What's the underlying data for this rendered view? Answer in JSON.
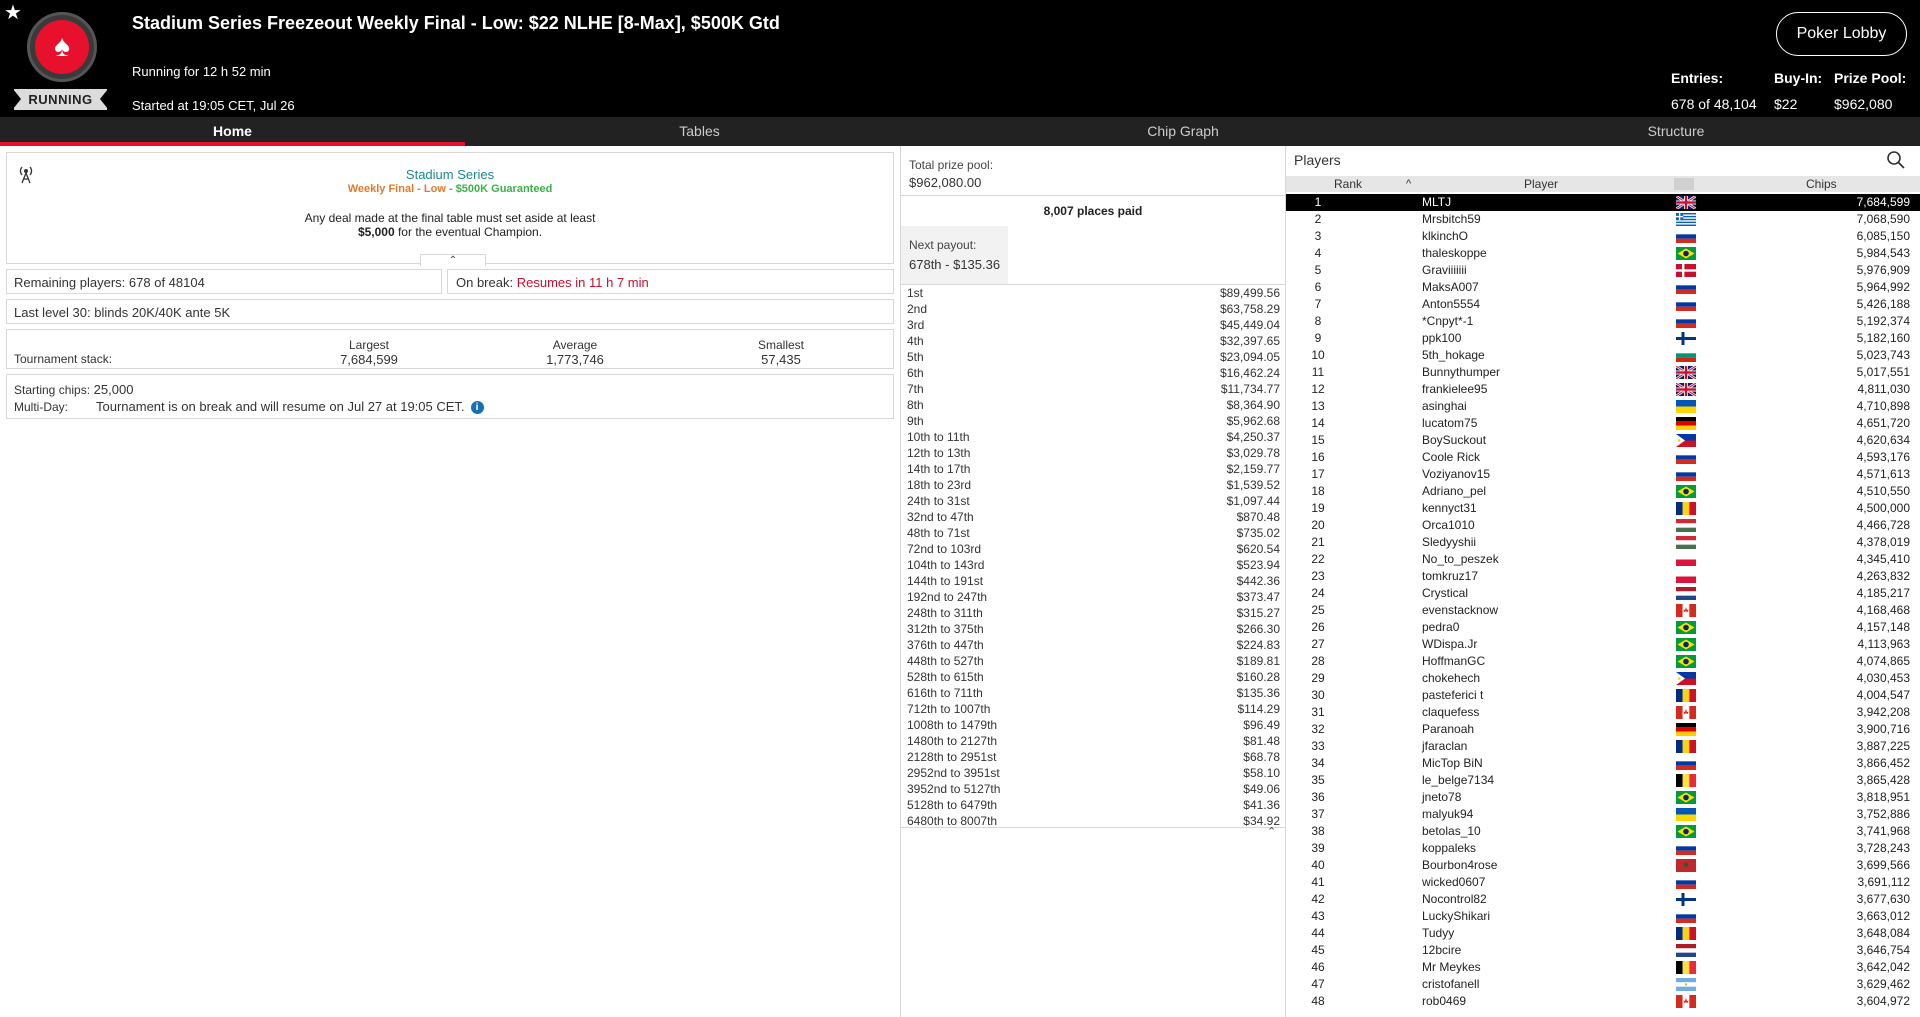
{
  "header": {
    "title": "Stadium Series Freezeout Weekly Final - Low: $22 NLHE [8-Max], $500K Gtd",
    "running_for": "Running for 12 h 52 min",
    "started_at": "Started at 19:05 CET, Jul 26",
    "status": "RUNNING",
    "lobby_button": "Poker Lobby",
    "entries_label": "Entries:",
    "entries_value": "678 of 48,104",
    "buyin_label": "Buy-In:",
    "buyin_value": "$22",
    "prizepool_label": "Prize Pool:",
    "prizepool_value": "$962,080"
  },
  "tabs": [
    "Home",
    "Tables",
    "Chip Graph",
    "Structure"
  ],
  "promo": {
    "line1": "Stadium Series",
    "line2_a": "Weekly Final - Low",
    "line2_sep": " - ",
    "line2_b": "$500K Guaranteed",
    "line3": "Any deal made at the final table must set aside at least",
    "line4_bold": "$5,000",
    "line4_rest": " for the eventual Champion."
  },
  "info": {
    "remaining_label": "Remaining players:",
    "remaining_value": "678 of 48104",
    "break_label": "On break:",
    "break_value": "Resumes in 11 h 7 min",
    "last_level_label": "Last level 30:",
    "last_level_value": "blinds 20K/40K ante 5K",
    "stack_label": "Tournament stack:",
    "largest_label": "Largest",
    "largest_value": "7,684,599",
    "average_label": "Average",
    "average_value": "1,773,746",
    "smallest_label": "Smallest",
    "smallest_value": "57,435",
    "starting_label": "Starting chips:",
    "starting_value": "25,000",
    "multiday_label": "Multi-Day:",
    "multiday_value": "Tournament is on break and will resume on Jul 27 at 19:05 CET."
  },
  "prizes": {
    "total_label": "Total prize pool:",
    "total_value": "$962,080.00",
    "places_paid": "8,007 places paid",
    "next_label": "Next payout:",
    "next_value": "678th - $135.36",
    "rows": [
      [
        "1st",
        "$89,499.56"
      ],
      [
        "2nd",
        "$63,758.29"
      ],
      [
        "3rd",
        "$45,449.04"
      ],
      [
        "4th",
        "$32,397.65"
      ],
      [
        "5th",
        "$23,094.05"
      ],
      [
        "6th",
        "$16,462.24"
      ],
      [
        "7th",
        "$11,734.77"
      ],
      [
        "8th",
        "$8,364.90"
      ],
      [
        "9th",
        "$5,962.68"
      ],
      [
        "10th to 11th",
        "$4,250.37"
      ],
      [
        "12th to 13th",
        "$3,029.78"
      ],
      [
        "14th to 17th",
        "$2,159.77"
      ],
      [
        "18th to 23rd",
        "$1,539.52"
      ],
      [
        "24th to 31st",
        "$1,097.44"
      ],
      [
        "32nd to 47th",
        "$870.48"
      ],
      [
        "48th to 71st",
        "$735.02"
      ],
      [
        "72nd to 103rd",
        "$620.54"
      ],
      [
        "104th to 143rd",
        "$523.94"
      ],
      [
        "144th to 191st",
        "$442.36"
      ],
      [
        "192nd to 247th",
        "$373.47"
      ],
      [
        "248th to 311th",
        "$315.27"
      ],
      [
        "312th to 375th",
        "$266.30"
      ],
      [
        "376th to 447th",
        "$224.83"
      ],
      [
        "448th to 527th",
        "$189.81"
      ],
      [
        "528th to 615th",
        "$160.28"
      ],
      [
        "616th to 711th",
        "$135.36"
      ],
      [
        "712th to 1007th",
        "$114.29"
      ],
      [
        "1008th to 1479th",
        "$96.49"
      ],
      [
        "1480th to 2127th",
        "$81.48"
      ],
      [
        "2128th to 2951st",
        "$68.78"
      ],
      [
        "2952nd to 3951st",
        "$58.10"
      ],
      [
        "3952nd to 5127th",
        "$49.06"
      ],
      [
        "5128th to 6479th",
        "$41.36"
      ],
      [
        "6480th to 8007th",
        "$34.92"
      ]
    ]
  },
  "players": {
    "title": "Players",
    "col_rank": "Rank",
    "col_player": "Player",
    "col_chips": "Chips",
    "rows": [
      [
        "1",
        "MLTJ",
        "7,684,599",
        "gb"
      ],
      [
        "2",
        "Mrsbitch59",
        "7,068,590",
        "gr"
      ],
      [
        "3",
        "klkinchO",
        "6,085,150",
        "ru"
      ],
      [
        "4",
        "thaleskoppe",
        "5,984,543",
        "br"
      ],
      [
        "5",
        "Graviiiiiii",
        "5,976,909",
        "dk"
      ],
      [
        "6",
        "MaksA007",
        "5,964,992",
        "ru"
      ],
      [
        "7",
        "Anton5554",
        "5,426,188",
        "ru"
      ],
      [
        "8",
        "*Cnpyt*-1",
        "5,192,374",
        "ru"
      ],
      [
        "9",
        "ppk100",
        "5,182,160",
        "fi"
      ],
      [
        "10",
        "5th_hokage",
        "5,023,743",
        "bg"
      ],
      [
        "11",
        "Bunnythumper",
        "5,017,551",
        "gb"
      ],
      [
        "12",
        "frankielee95",
        "4,811,030",
        "gb"
      ],
      [
        "13",
        "asinghai",
        "4,710,898",
        "ua"
      ],
      [
        "14",
        "lucatom75",
        "4,651,720",
        "de"
      ],
      [
        "15",
        "BoySuckout",
        "4,620,634",
        "ph"
      ],
      [
        "16",
        "Coole Rick",
        "4,593,176",
        "ru"
      ],
      [
        "17",
        "Voziyanov15",
        "4,571,613",
        "ru"
      ],
      [
        "18",
        "Adriano_pel",
        "4,510,550",
        "br"
      ],
      [
        "19",
        "kennyct31",
        "4,500,000",
        "ro"
      ],
      [
        "20",
        "Orca1010",
        "4,466,728",
        "hu"
      ],
      [
        "21",
        "Sledyyshii",
        "4,378,019",
        "hu"
      ],
      [
        "22",
        "No_to_peszek",
        "4,345,410",
        "pl"
      ],
      [
        "23",
        "tomkruz17",
        "4,263,832",
        "pl"
      ],
      [
        "24",
        "Crystical",
        "4,185,217",
        "nl"
      ],
      [
        "25",
        "evenstacknow",
        "4,168,468",
        "ca"
      ],
      [
        "26",
        "pedra0",
        "4,157,148",
        "br"
      ],
      [
        "27",
        "WDispa.Jr",
        "4,113,963",
        "br"
      ],
      [
        "28",
        "HoffmanGC",
        "4,074,865",
        "br"
      ],
      [
        "29",
        "chokehech",
        "4,030,453",
        "ph"
      ],
      [
        "30",
        "pasteferici t",
        "4,004,547",
        "ro"
      ],
      [
        "31",
        "claquefess",
        "3,942,208",
        "ca"
      ],
      [
        "32",
        "Paranoah",
        "3,900,716",
        "de"
      ],
      [
        "33",
        "jfaraclan",
        "3,887,225",
        "ro"
      ],
      [
        "34",
        "MicTop BiN",
        "3,866,452",
        "ru"
      ],
      [
        "35",
        "le_belge7134",
        "3,865,428",
        "be"
      ],
      [
        "36",
        "jneto78",
        "3,818,951",
        "br"
      ],
      [
        "37",
        "malyuk94",
        "3,752,886",
        "ua"
      ],
      [
        "38",
        "betolas_10",
        "3,741,968",
        "br"
      ],
      [
        "39",
        "koppaleks",
        "3,728,243",
        "ru"
      ],
      [
        "40",
        "Bourbon4rose",
        "3,699,566",
        "ma"
      ],
      [
        "41",
        "wicked0607",
        "3,691,112",
        "ru"
      ],
      [
        "42",
        "Nocontrol82",
        "3,677,630",
        "fi"
      ],
      [
        "43",
        "LuckyShikari",
        "3,663,012",
        "ru"
      ],
      [
        "44",
        "Tudyy",
        "3,648,084",
        "ro"
      ],
      [
        "45",
        "12bcire",
        "3,646,754",
        "nl"
      ],
      [
        "46",
        "Mr Meykes",
        "3,642,042",
        "be"
      ],
      [
        "47",
        "cristofanell",
        "3,629,462",
        "ar"
      ],
      [
        "48",
        "rob0469",
        "3,604,972",
        "ca"
      ]
    ]
  }
}
